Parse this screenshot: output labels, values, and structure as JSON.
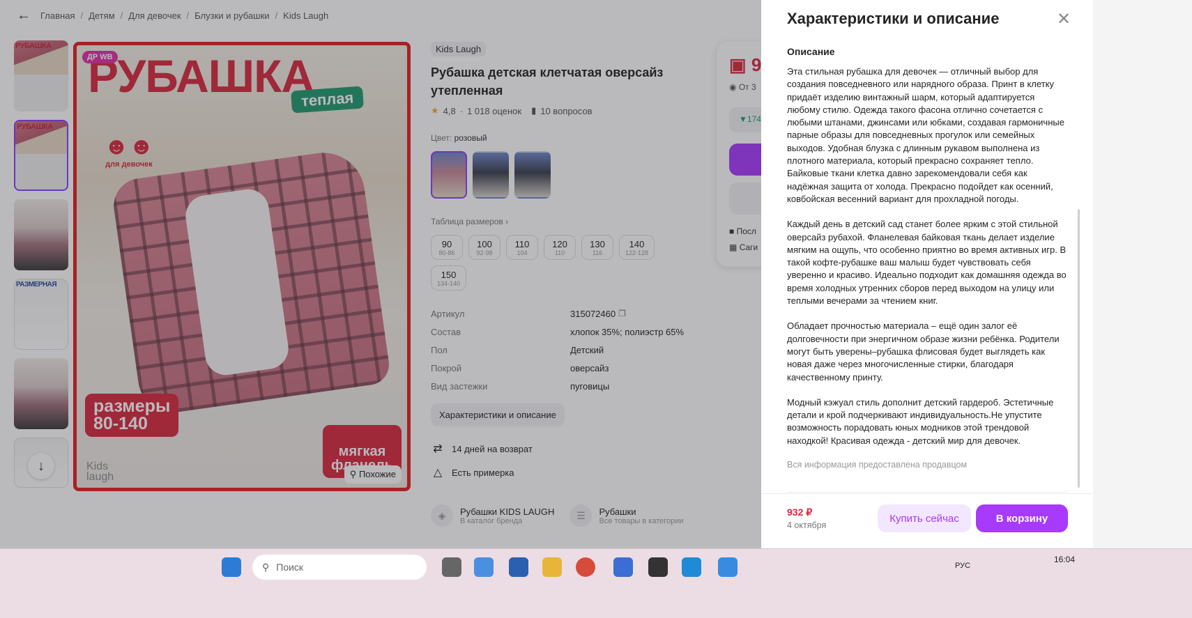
{
  "breadcrumbs": [
    "Главная",
    "Детям",
    "Для девочек",
    "Блузки и рубашки",
    "Kids Laugh"
  ],
  "image": {
    "badge": "ДР WB",
    "title": "РУБАШКА",
    "subtitle": "теплая",
    "girls_label": "для девочек",
    "sizes_line1": "размеры",
    "sizes_line2": "80-140",
    "flannel_line1": "мягкая",
    "flannel_line2": "фланель",
    "brand_line1": "Kids",
    "brand_line2": "laugh",
    "similar_label": "Похожие"
  },
  "thumbs": [
    {
      "label": "РУБАШКА"
    },
    {
      "label": "РУБАШКА"
    },
    {
      "label": ""
    },
    {
      "label": "РАЗМЕРНАЯ"
    },
    {
      "label": ""
    },
    {
      "label": ""
    }
  ],
  "product": {
    "brand": "Kids Laugh",
    "title": "Рубашка детская клетчатая оверсайз утепленная",
    "rating": "4,8",
    "reviews": "1 018 оценок",
    "questions": "10 вопросов",
    "color_label": "Цвет:",
    "color_value": "розовый",
    "size_table_label": "Таблица размеров",
    "sizes": [
      {
        "size": "90",
        "height": "80-86"
      },
      {
        "size": "100",
        "height": "92-98"
      },
      {
        "size": "110",
        "height": "104"
      },
      {
        "size": "120",
        "height": "110"
      },
      {
        "size": "130",
        "height": "116"
      },
      {
        "size": "140",
        "height": "122-128"
      },
      {
        "size": "150",
        "height": "134-140"
      }
    ],
    "specs": [
      {
        "key": "Артикул",
        "value": "315072460"
      },
      {
        "key": "Состав",
        "value": "хлопок 35%; полиэстр 65%"
      },
      {
        "key": "Пол",
        "value": "Детский"
      },
      {
        "key": "Покрой",
        "value": "оверсайз"
      },
      {
        "key": "Вид застежки",
        "value": "пуговицы"
      }
    ],
    "desc_button": "Характеристики и описание",
    "return_text": "14 дней на возврат",
    "fitting_text": "Есть примерка",
    "brand_link_title": "Рубашки KIDS LAUGH",
    "brand_link_sub": "В каталог бренда",
    "cat_link_title": "Рубашки",
    "cat_link_sub": "Все товары в категории"
  },
  "price_card": {
    "price_partial": "9",
    "from_partial": "От 3",
    "trend_partial": "174",
    "line1_partial": "Посл",
    "line2_partial": "Саги"
  },
  "panel": {
    "title": "Характеристики и описание",
    "section_heading": "Описание",
    "paragraphs": [
      "Эта стильная рубашка для девочек — отличный выбор для создания повседневного или нарядного образа. Принт в клетку придаёт изделию винтажный шарм, который адаптируется любому стилю. Одежда такого фасона отлично сочетается с любыми штанами, джинсами или юбками, создавая гармоничные парные образы для повседневных прогулок или семейных выходов. Удобная блузка с длинным рукавом выполнена из плотного материала, который прекрасно сохраняет тепло. Байковые ткани клетка давно зарекомендовали себя как надёжная защита от холода. Прекрасно подойдет как осенний, ковбойская весенний вариант для прохладной погоды.",
      "Каждый день в детский сад станет более ярким с этой стильной оверсайз рубахой. Фланелевая байковая ткань делает изделие мягким на ощупь, что особенно приятно во время активных игр. В такой кофте-рубашке ваш малыш будет чувствовать себя уверенно и красиво. Идеально подходит как домашняя одежда во время холодных утренних сборов перед выходом на улицу или теплыми вечерами за чтением книг.",
      "Обладает прочностью материала – ещё один залог её долговечности при энергичном образе жизни ребёнка. Родители могут быть уверены–рубашка флисовая будет выглядеть как новая даже через многочисленные стирки, благодаря качественному принту.",
      "Модный кэжуал стиль дополнит детский гардероб. Эстетичные детали и крой подчеркивают индивидуальность.Не упустите возможность порадовать юных модников этой трендовой находкой! Красивая одежда - детский мир для девочек."
    ],
    "footnote": "Вся информация предоставлена продавцом",
    "footer_price": "932 ₽",
    "footer_date": "4 октября",
    "buy_now": "Купить сейчас",
    "to_cart": "В корзину"
  },
  "taskbar": {
    "search_placeholder": "Поиск",
    "lang": "РУС",
    "time": "16:04"
  },
  "colors": {
    "accent": "#a73afd",
    "price": "#d8283d",
    "banner_red": "#d8283d",
    "banner_green": "#219a6c"
  }
}
